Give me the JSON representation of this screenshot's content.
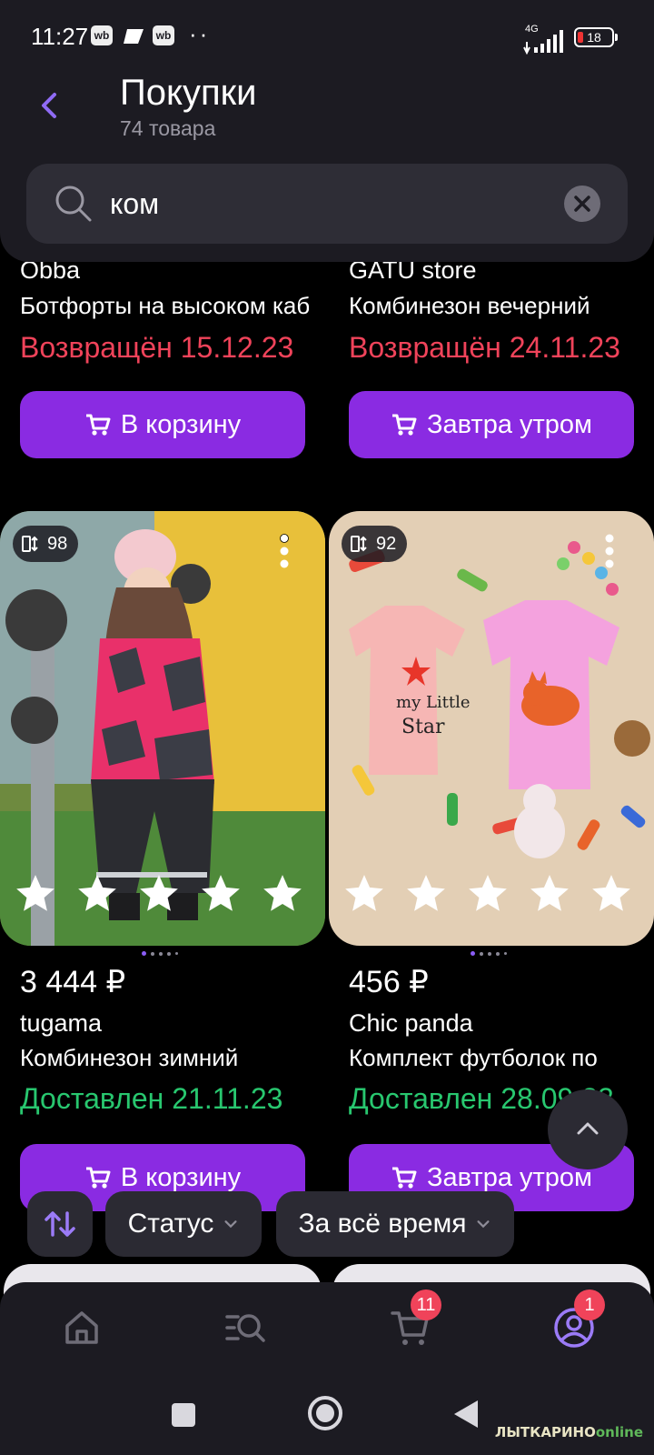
{
  "status_bar": {
    "time": "11:27",
    "chips": [
      "wb",
      "wb"
    ],
    "dots": "··",
    "network": "4G",
    "battery": "18"
  },
  "header": {
    "title": "Покупки",
    "subtitle": "74 товара"
  },
  "search": {
    "value": "ком",
    "placeholder": ""
  },
  "products_top": [
    {
      "brand": "Obba",
      "name": "Ботфорты на высоком каблуке",
      "status": "Возвращён 15.12.23",
      "button": "В корзину"
    },
    {
      "brand": "GATU store",
      "name": "Комбинезон вечерний",
      "status": "Возвращён 24.11.23",
      "button": "Завтра утром"
    }
  ],
  "products": [
    {
      "count": "98",
      "rating_stars": 5,
      "price": "3 444 ₽",
      "brand": "tugama",
      "name": "Комбинезон зимний",
      "status": "Доставлен 21.11.23",
      "button": "В корзину"
    },
    {
      "count": "92",
      "rating_stars": 5,
      "price": "456 ₽",
      "brand": "Chic panda",
      "name": "Комплект футболок по",
      "status": "Доставлен 28.09.23",
      "button": "Завтра утром"
    }
  ],
  "filters": {
    "status_label": "Статус",
    "period_label": "За всё время"
  },
  "tabbar": {
    "cart_badge": "11",
    "profile_badge": "1"
  },
  "watermark": {
    "text_main": "ЛЫТКАРИНО",
    "text_accent": "online"
  },
  "colors": {
    "accent": "#8a2be2",
    "returned": "#f0435a",
    "delivered": "#28c76f",
    "background": "#000000",
    "surface": "#1c1b22"
  }
}
